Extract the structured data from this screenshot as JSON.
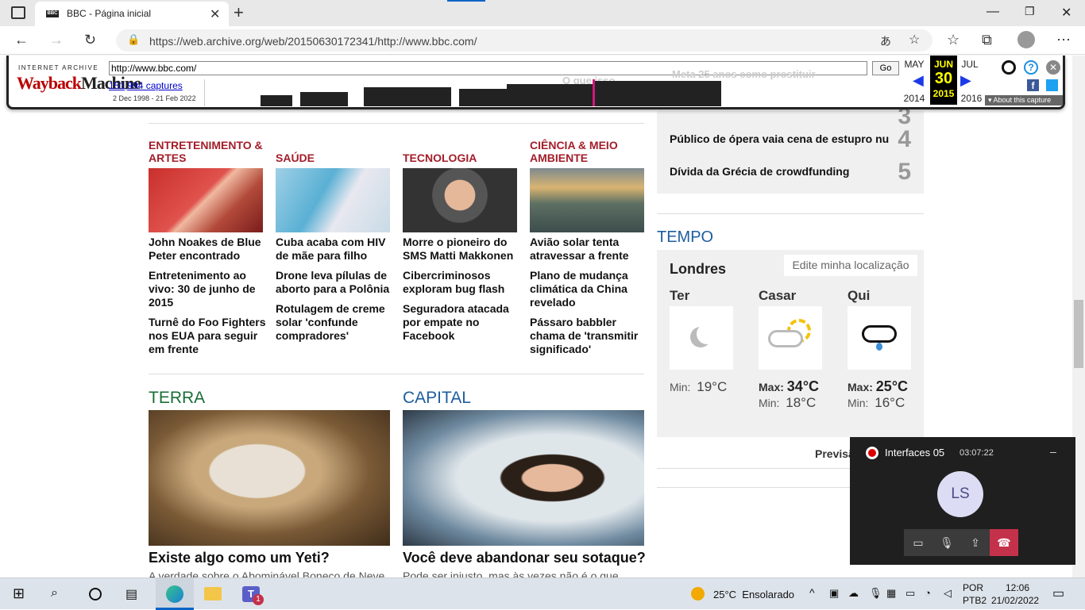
{
  "browser": {
    "tab_title": "BBC - Página inicial",
    "tab_favicon": "BBC",
    "url": "https://web.archive.org/web/20150630172341/http://www.bbc.com/"
  },
  "wayback": {
    "brand_top": "INTERNET ARCHIVE",
    "brand_logo_a": "Wayback",
    "brand_logo_b": "Machine",
    "url_input": "http://www.bbc.com/",
    "go_label": "Go",
    "captures": "151,994 captures",
    "range": "2 Dec 1998 - 21 Feb 2022",
    "prev_month": "MAY",
    "cur_month": "JUN",
    "next_month": "JUL",
    "cur_day": "30",
    "prev_year": "2014",
    "cur_year": "2015",
    "next_year": "2016",
    "about": "About this capture",
    "ghost_text_a": "O que isso",
    "ghost_text_b": "Meta 25 anos como prostituir"
  },
  "sections": [
    {
      "heading": "ENTRETENIMENTO & ARTES",
      "headlines": [
        "John Noakes de Blue Peter encontrado",
        "Entretenimento ao vivo: 30 de junho de 2015",
        "Turnê do Foo Fighters nos EUA para seguir em frente"
      ]
    },
    {
      "heading": "SAÚDE",
      "headlines": [
        "Cuba acaba com HIV de mãe para filho",
        "Drone leva pílulas de aborto para a Polônia",
        "Rotulagem de creme solar 'confunde compradores'"
      ]
    },
    {
      "heading": "TECNOLOGIA",
      "headlines": [
        "Morre o pioneiro do SMS Matti Makkonen",
        "Cibercriminosos exploram bug flash",
        "Seguradora atacada por empate no Facebook"
      ]
    },
    {
      "heading": "CIÊNCIA & MEIO AMBIENTE",
      "headlines": [
        "Avião solar tenta atravessar a frente",
        "Plano de mudança climática da China revelado",
        "Pássaro babbler chama de 'transmitir significado'"
      ]
    }
  ],
  "features": {
    "terra": {
      "heading": "TERRA",
      "title": "Existe algo como um Yeti?",
      "summary": "A verdade sobre o Abominável Boneco de Neve"
    },
    "capital": {
      "heading": "CAPITAL",
      "title": "Você deve abandonar seu sotaque?",
      "summary": "Pode ser injusto, mas às vezes não é o que"
    }
  },
  "popular": {
    "items": [
      {
        "title": "Público de ópera vaia cena de estupro nu",
        "rank": "4"
      },
      {
        "title": "Dívida da Grécia de crowdfunding",
        "rank": "5"
      }
    ],
    "partial_rank": "3"
  },
  "weather": {
    "heading": "TEMPO",
    "city": "Londres",
    "edit_label": "Edite minha localização",
    "days": [
      {
        "day": "Ter",
        "icon": "moon-icon",
        "min_label": "Min:",
        "min": "19°C"
      },
      {
        "day": "Casar",
        "icon": "sun-cloud-icon",
        "max_label": "Max:",
        "max": "34°C",
        "min_label": "Min:",
        "min": "18°C"
      },
      {
        "day": "Qui",
        "icon": "rain-cloud-icon",
        "max_label": "Max:",
        "max": "25°C",
        "min_label": "Min:",
        "min": "16°C"
      }
    ],
    "forecast_partial": "Previsã"
  },
  "call": {
    "title": "Interfaces 05",
    "time": "03:07:22",
    "avatar": "LS",
    "minimize": "–"
  },
  "taskbar": {
    "weather": "25°C  Ensolarado",
    "lang_a": "POR",
    "lang_b": "PTB2",
    "time": "12:06",
    "date": "21/02/2022",
    "teams_badge": "1"
  },
  "colors": {
    "section_red": "#a31d2a",
    "terra_green": "#1a6e37",
    "capital_blue": "#1d5d9e",
    "tempo_blue": "#1d5d9e",
    "wayback_yellow": "#ffff00"
  }
}
